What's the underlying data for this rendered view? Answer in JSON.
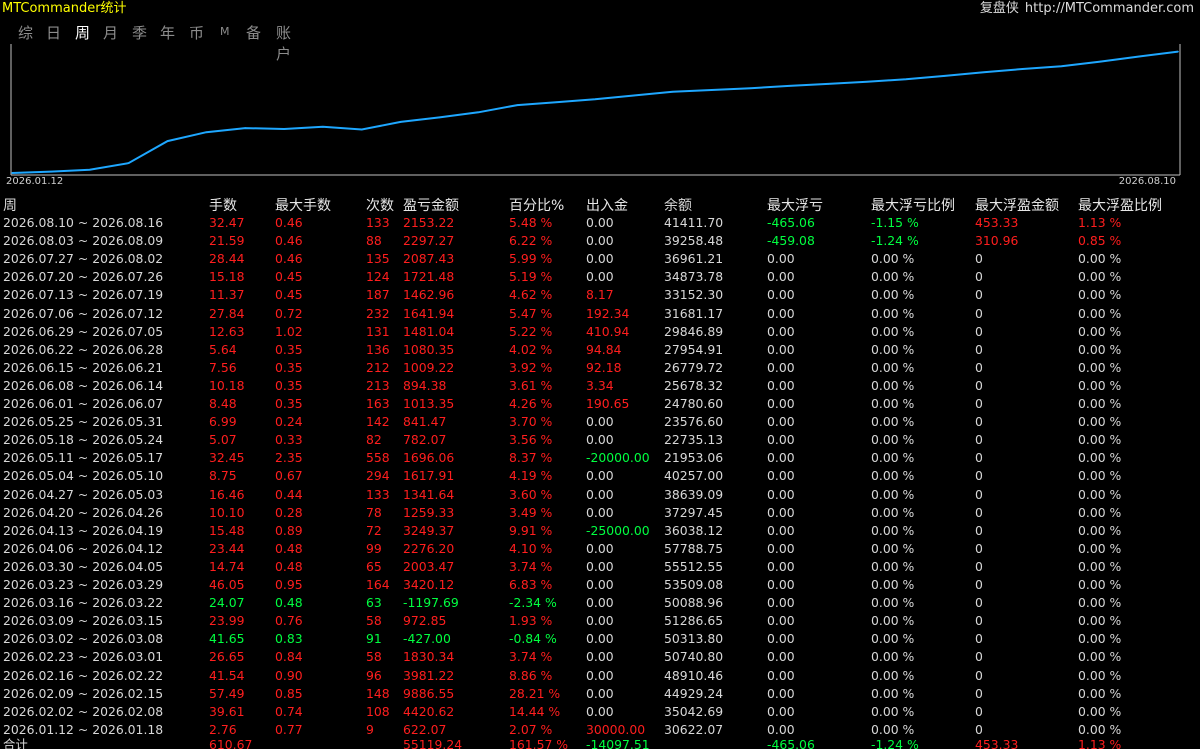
{
  "titlebar": {
    "title": "MTCommander统计",
    "brand": "复盘侠",
    "url": "http://MTCommander.com"
  },
  "tabs": [
    {
      "label": "综",
      "active": false
    },
    {
      "label": "日",
      "active": false
    },
    {
      "label": "周",
      "active": true
    },
    {
      "label": "月",
      "active": false
    },
    {
      "label": "季",
      "active": false
    },
    {
      "label": "年",
      "active": false
    },
    {
      "label": "币",
      "active": false
    },
    {
      "label": "M",
      "active": false
    },
    {
      "label": "备",
      "active": false
    },
    {
      "label": "账户",
      "active": false
    }
  ],
  "chart_data": {
    "type": "line",
    "x_start_label": "2026.01.12",
    "x_end_label": "2026.08.10",
    "line_color": "#1ea7ff",
    "ylim": [
      0,
      56000
    ],
    "x": [
      "2026.01.12",
      "2026.01.19",
      "2026.01.26",
      "2026.02.02",
      "2026.02.09",
      "2026.02.16",
      "2026.02.23",
      "2026.03.02",
      "2026.03.09",
      "2026.03.16",
      "2026.03.23",
      "2026.03.30",
      "2026.04.06",
      "2026.04.13",
      "2026.04.20",
      "2026.04.27",
      "2026.05.04",
      "2026.05.11",
      "2026.05.18",
      "2026.05.25",
      "2026.06.01",
      "2026.06.08",
      "2026.06.15",
      "2026.06.22",
      "2026.06.29",
      "2026.07.06",
      "2026.07.13",
      "2026.07.20",
      "2026.07.27",
      "2026.08.03",
      "2026.08.10"
    ],
    "values": [
      0,
      622,
      1500,
      4420,
      14300,
      18300,
      20100,
      19700,
      20700,
      19500,
      22900,
      24900,
      27200,
      30400,
      31700,
      33000,
      34700,
      36400,
      37200,
      38000,
      39000,
      39900,
      40900,
      42000,
      43500,
      45100,
      46600,
      47800,
      49900,
      52200,
      54400
    ]
  },
  "table": {
    "headers": [
      "周",
      "手数",
      "最大手数",
      "次数",
      "盈亏金额",
      "百分比%",
      "出入金",
      "余额",
      "最大浮亏",
      "最大浮亏比例",
      "最大浮盈金额",
      "最大浮盈比例"
    ],
    "rows": [
      [
        "2026.08.10 ~ 2026.08.16",
        "32.47",
        "0.46",
        "133",
        "2153.22",
        "5.48 %",
        "0.00",
        "41411.70",
        "-465.06",
        "-1.15 %",
        "453.33",
        "1.13 %"
      ],
      [
        "2026.08.03 ~ 2026.08.09",
        "21.59",
        "0.46",
        "88",
        "2297.27",
        "6.22 %",
        "0.00",
        "39258.48",
        "-459.08",
        "-1.24 %",
        "310.96",
        "0.85 %"
      ],
      [
        "2026.07.27 ~ 2026.08.02",
        "28.44",
        "0.46",
        "135",
        "2087.43",
        "5.99 %",
        "0.00",
        "36961.21",
        "0.00",
        "0.00 %",
        "0",
        "0.00 %"
      ],
      [
        "2026.07.20 ~ 2026.07.26",
        "15.18",
        "0.45",
        "124",
        "1721.48",
        "5.19 %",
        "0.00",
        "34873.78",
        "0.00",
        "0.00 %",
        "0",
        "0.00 %"
      ],
      [
        "2026.07.13 ~ 2026.07.19",
        "11.37",
        "0.45",
        "187",
        "1462.96",
        "4.62 %",
        "8.17",
        "33152.30",
        "0.00",
        "0.00 %",
        "0",
        "0.00 %"
      ],
      [
        "2026.07.06 ~ 2026.07.12",
        "27.84",
        "0.72",
        "232",
        "1641.94",
        "5.47 %",
        "192.34",
        "31681.17",
        "0.00",
        "0.00 %",
        "0",
        "0.00 %"
      ],
      [
        "2026.06.29 ~ 2026.07.05",
        "12.63",
        "1.02",
        "131",
        "1481.04",
        "5.22 %",
        "410.94",
        "29846.89",
        "0.00",
        "0.00 %",
        "0",
        "0.00 %"
      ],
      [
        "2026.06.22 ~ 2026.06.28",
        "5.64",
        "0.35",
        "136",
        "1080.35",
        "4.02 %",
        "94.84",
        "27954.91",
        "0.00",
        "0.00 %",
        "0",
        "0.00 %"
      ],
      [
        "2026.06.15 ~ 2026.06.21",
        "7.56",
        "0.35",
        "212",
        "1009.22",
        "3.92 %",
        "92.18",
        "26779.72",
        "0.00",
        "0.00 %",
        "0",
        "0.00 %"
      ],
      [
        "2026.06.08 ~ 2026.06.14",
        "10.18",
        "0.35",
        "213",
        "894.38",
        "3.61 %",
        "3.34",
        "25678.32",
        "0.00",
        "0.00 %",
        "0",
        "0.00 %"
      ],
      [
        "2026.06.01 ~ 2026.06.07",
        "8.48",
        "0.35",
        "163",
        "1013.35",
        "4.26 %",
        "190.65",
        "24780.60",
        "0.00",
        "0.00 %",
        "0",
        "0.00 %"
      ],
      [
        "2026.05.25 ~ 2026.05.31",
        "6.99",
        "0.24",
        "142",
        "841.47",
        "3.70 %",
        "0.00",
        "23576.60",
        "0.00",
        "0.00 %",
        "0",
        "0.00 %"
      ],
      [
        "2026.05.18 ~ 2026.05.24",
        "5.07",
        "0.33",
        "82",
        "782.07",
        "3.56 %",
        "0.00",
        "22735.13",
        "0.00",
        "0.00 %",
        "0",
        "0.00 %"
      ],
      [
        "2026.05.11 ~ 2026.05.17",
        "32.45",
        "2.35",
        "558",
        "1696.06",
        "8.37 %",
        "-20000.00",
        "21953.06",
        "0.00",
        "0.00 %",
        "0",
        "0.00 %"
      ],
      [
        "2026.05.04 ~ 2026.05.10",
        "8.75",
        "0.67",
        "294",
        "1617.91",
        "4.19 %",
        "0.00",
        "40257.00",
        "0.00",
        "0.00 %",
        "0",
        "0.00 %"
      ],
      [
        "2026.04.27 ~ 2026.05.03",
        "16.46",
        "0.44",
        "133",
        "1341.64",
        "3.60 %",
        "0.00",
        "38639.09",
        "0.00",
        "0.00 %",
        "0",
        "0.00 %"
      ],
      [
        "2026.04.20 ~ 2026.04.26",
        "10.10",
        "0.28",
        "78",
        "1259.33",
        "3.49 %",
        "0.00",
        "37297.45",
        "0.00",
        "0.00 %",
        "0",
        "0.00 %"
      ],
      [
        "2026.04.13 ~ 2026.04.19",
        "15.48",
        "0.89",
        "72",
        "3249.37",
        "9.91 %",
        "-25000.00",
        "36038.12",
        "0.00",
        "0.00 %",
        "0",
        "0.00 %"
      ],
      [
        "2026.04.06 ~ 2026.04.12",
        "23.44",
        "0.48",
        "99",
        "2276.20",
        "4.10 %",
        "0.00",
        "57788.75",
        "0.00",
        "0.00 %",
        "0",
        "0.00 %"
      ],
      [
        "2026.03.30 ~ 2026.04.05",
        "14.74",
        "0.48",
        "65",
        "2003.47",
        "3.74 %",
        "0.00",
        "55512.55",
        "0.00",
        "0.00 %",
        "0",
        "0.00 %"
      ],
      [
        "2026.03.23 ~ 2026.03.29",
        "46.05",
        "0.95",
        "164",
        "3420.12",
        "6.83 %",
        "0.00",
        "53509.08",
        "0.00",
        "0.00 %",
        "0",
        "0.00 %"
      ],
      [
        "2026.03.16 ~ 2026.03.22",
        "24.07",
        "0.48",
        "63",
        "-1197.69",
        "-2.34 %",
        "0.00",
        "50088.96",
        "0.00",
        "0.00 %",
        "0",
        "0.00 %"
      ],
      [
        "2026.03.09 ~ 2026.03.15",
        "23.99",
        "0.76",
        "58",
        "972.85",
        "1.93 %",
        "0.00",
        "51286.65",
        "0.00",
        "0.00 %",
        "0",
        "0.00 %"
      ],
      [
        "2026.03.02 ~ 2026.03.08",
        "41.65",
        "0.83",
        "91",
        "-427.00",
        "-0.84 %",
        "0.00",
        "50313.80",
        "0.00",
        "0.00 %",
        "0",
        "0.00 %"
      ],
      [
        "2026.02.23 ~ 2026.03.01",
        "26.65",
        "0.84",
        "58",
        "1830.34",
        "3.74 %",
        "0.00",
        "50740.80",
        "0.00",
        "0.00 %",
        "0",
        "0.00 %"
      ],
      [
        "2026.02.16 ~ 2026.02.22",
        "41.54",
        "0.90",
        "96",
        "3981.22",
        "8.86 %",
        "0.00",
        "48910.46",
        "0.00",
        "0.00 %",
        "0",
        "0.00 %"
      ],
      [
        "2026.02.09 ~ 2026.02.15",
        "57.49",
        "0.85",
        "148",
        "9886.55",
        "28.21 %",
        "0.00",
        "44929.24",
        "0.00",
        "0.00 %",
        "0",
        "0.00 %"
      ],
      [
        "2026.02.02 ~ 2026.02.08",
        "39.61",
        "0.74",
        "108",
        "4420.62",
        "14.44 %",
        "0.00",
        "35042.69",
        "0.00",
        "0.00 %",
        "0",
        "0.00 %"
      ],
      [
        "2026.01.12 ~ 2026.01.18",
        "2.76",
        "0.77",
        "9",
        "622.07",
        "2.07 %",
        "30000.00",
        "30622.07",
        "0.00",
        "0.00 %",
        "0",
        "0.00 %"
      ]
    ],
    "total": [
      "合计",
      "610.67",
      "",
      "",
      "55119.24",
      "161.57 %",
      "-14097.51",
      "",
      "-465.06",
      "-1.24 %",
      "453.33",
      "1.13 %"
    ]
  },
  "colors": {
    "background": "#000000",
    "title": "#ffff00",
    "positive": "#ff1e1e",
    "negative": "#00ff40",
    "neutral": "#d8d8d8",
    "line": "#1ea7ff"
  }
}
